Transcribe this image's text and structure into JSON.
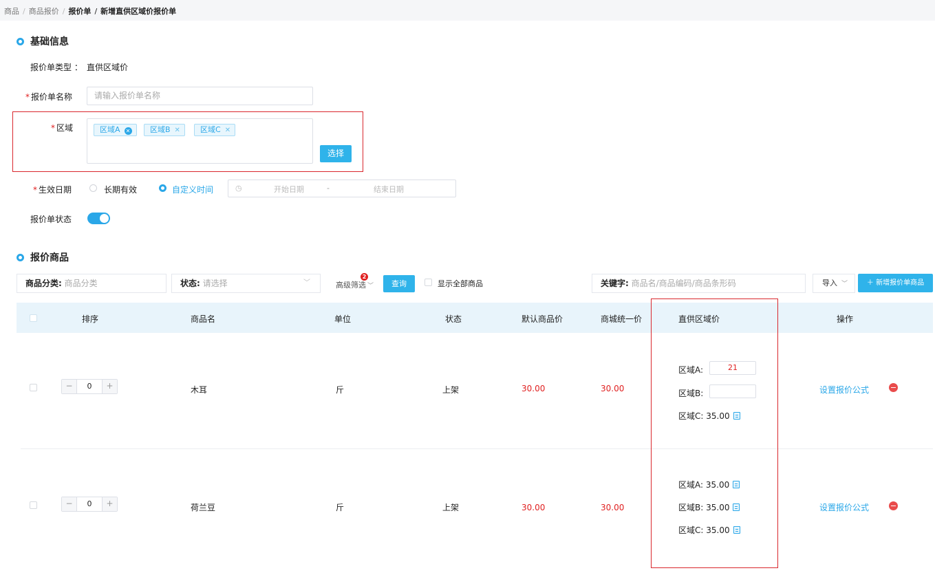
{
  "breadcrumb": [
    "商品",
    "商品报价",
    "报价单",
    "新增直供区域价报价单"
  ],
  "basic": {
    "title": "基础信息",
    "type_label": "报价单类型 ：",
    "type_value": "直供区域价",
    "name_label": "报价单名称",
    "name_placeholder": "请输入报价单名称",
    "region_label": "区域",
    "regions": [
      "区域A",
      "区域B",
      "区域C"
    ],
    "select_button": "选择",
    "date_label": "生效日期",
    "date_options": [
      "长期有效",
      "自定义时间"
    ],
    "date_selected": "自定义时间",
    "start_placeholder": "开始日期",
    "date_sep": "-",
    "end_placeholder": "结束日期",
    "status_label": "报价单状态",
    "status_on": true
  },
  "goods": {
    "title": "报价商品",
    "filter_category_label": "商品分类:",
    "filter_category_placeholder": "商品分类",
    "filter_status_label": "状态:",
    "filter_status_placeholder": "请选择",
    "advanced_filter": "高级筛选",
    "advanced_badge": "2",
    "query_button": "查询",
    "show_all": "显示全部商品",
    "keyword_label": "关键字:",
    "keyword_placeholder": "商品名/商品编码/商品条形码",
    "import_button": "导入",
    "add_button": "新增报价单商品",
    "columns": [
      "排序",
      "商品名",
      "单位",
      "状态",
      "默认商品价",
      "商城统一价",
      "直供区域价",
      "操作"
    ],
    "rows": [
      {
        "sort": "0",
        "name": "木耳",
        "unit": "斤",
        "status": "上架",
        "default_price": "30.00",
        "mall_price": "30.00",
        "region_a_label": "区域A:",
        "region_a_value": "21",
        "region_b_label": "区域B:",
        "region_b_value": "",
        "region_c_label": "区域C:",
        "region_c_value": "35.00",
        "action": "设置报价公式"
      },
      {
        "sort": "0",
        "name": "荷兰豆",
        "unit": "斤",
        "status": "上架",
        "default_price": "30.00",
        "mall_price": "30.00",
        "region_a_label": "区域A:",
        "region_a_value": "35.00",
        "region_b_label": "区域B:",
        "region_b_value": "35.00",
        "region_c_label": "区域C:",
        "region_c_value": "35.00",
        "action": "设置报价公式"
      }
    ]
  },
  "colors": {
    "accent": "#2aa7e8",
    "price_red": "#e02020",
    "highlight_box": "#d9262c"
  }
}
